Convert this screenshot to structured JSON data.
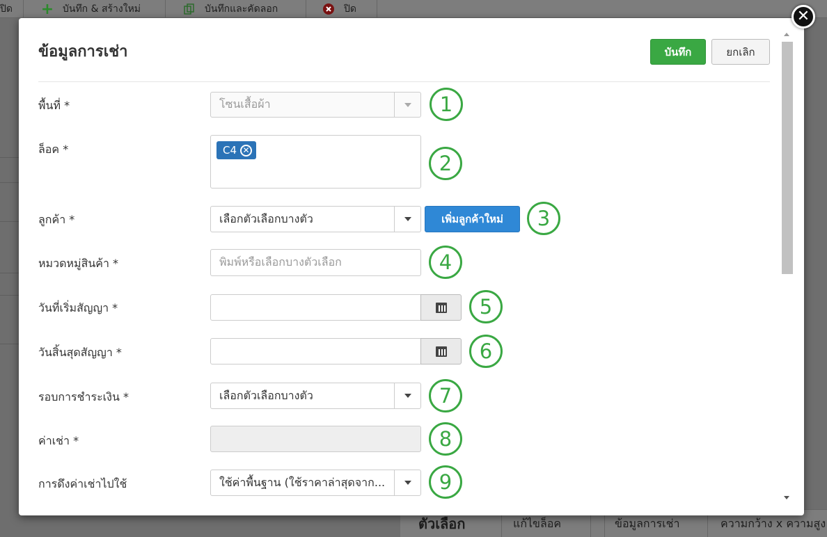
{
  "background": {
    "toolbar": {
      "close_left": "ปิด",
      "save_new": "บันทึก & สร้างใหม่",
      "save_copy": "บันทึกและคัดลอก",
      "close": "ปิด"
    },
    "bottom_tabs": {
      "title": "ตัวเลือก",
      "edit_lock": "แก้ไขล็อค",
      "rental_info": "ข้อมูลการเช่า",
      "dimensions": "ความกว้าง x ความสูง"
    }
  },
  "modal": {
    "title": "ข้อมูลการเช่า",
    "save_label": "บันทึก",
    "cancel_label": "ยกเลิก",
    "close_icon": "✕"
  },
  "form": {
    "area": {
      "label": "พื้นที่ *",
      "value": "โซนเสื้อผ้า"
    },
    "lock": {
      "label": "ล็อค *",
      "tag": "C4",
      "tag_remove": "✕"
    },
    "customer": {
      "label": "ลูกค้า *",
      "value": "เลือกตัวเลือกบางตัว",
      "add_label": "เพิ่มลูกค้าใหม่"
    },
    "category": {
      "label": "หมวดหมู่สินค้า *",
      "placeholder": "พิมพ์หรือเลือกบางตัวเลือก"
    },
    "start_date": {
      "label": "วันที่เริ่มสัญญา *",
      "value": ""
    },
    "end_date": {
      "label": "วันสิ้นสุดสัญญา *",
      "value": ""
    },
    "billing_cycle": {
      "label": "รอบการชำระเงิน *",
      "value": "เลือกตัวเลือกบางตัว"
    },
    "rent": {
      "label": "ค่าเช่า *",
      "value": ""
    },
    "rent_source": {
      "label": "การดึงค่าเช่าไปใช้",
      "value": "ใช้ค่าพื้นฐาน (ใช้ราคาล่าสุดจาก..."
    }
  },
  "markers": [
    "1",
    "2",
    "3",
    "4",
    "5",
    "6",
    "7",
    "8",
    "9"
  ],
  "colors": {
    "save_green": "#3aa843",
    "add_blue": "#2f88d6",
    "marker_green": "#3aa843",
    "tag_blue": "#2b73b7"
  }
}
